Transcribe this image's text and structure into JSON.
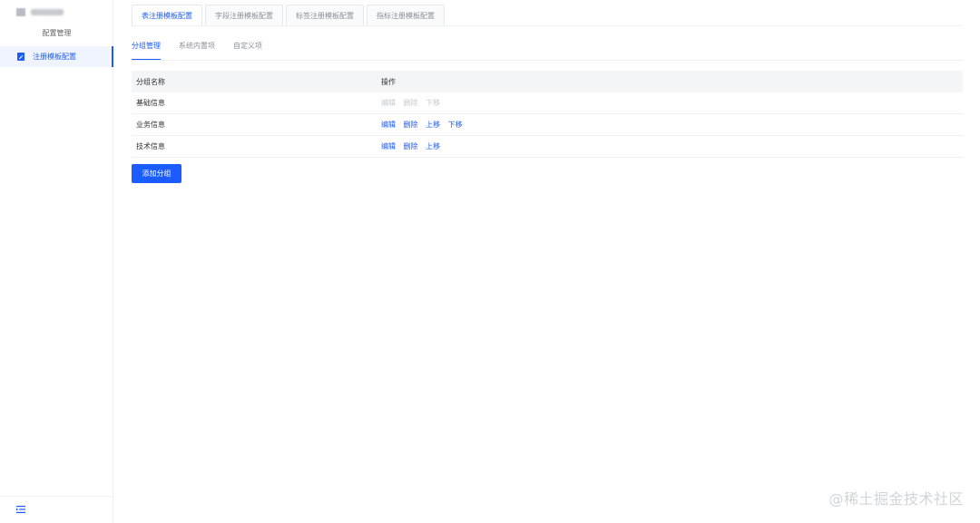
{
  "sidebar": {
    "group_title": "配置管理",
    "items": [
      {
        "label": "注册模板配置",
        "icon": "edit-doc-icon",
        "active": true
      }
    ],
    "collapse_icon": "menu-fold-icon"
  },
  "top_tabs": [
    {
      "label": "表注册模板配置",
      "active": true
    },
    {
      "label": "字段注册模板配置",
      "active": false
    },
    {
      "label": "标签注册模板配置",
      "active": false
    },
    {
      "label": "指标注册模板配置",
      "active": false
    }
  ],
  "sub_tabs": [
    {
      "label": "分组管理",
      "active": true
    },
    {
      "label": "系统内置项",
      "active": false
    },
    {
      "label": "自定义项",
      "active": false
    }
  ],
  "table": {
    "headers": {
      "name": "分组名称",
      "actions": "操作"
    },
    "rows": [
      {
        "name": "基础信息",
        "actions": [
          {
            "label": "编辑",
            "enabled": false
          },
          {
            "label": "删除",
            "enabled": false
          },
          {
            "label": "下移",
            "enabled": false
          }
        ]
      },
      {
        "name": "业务信息",
        "actions": [
          {
            "label": "编辑",
            "enabled": true
          },
          {
            "label": "删除",
            "enabled": true
          },
          {
            "label": "上移",
            "enabled": true
          },
          {
            "label": "下移",
            "enabled": true
          }
        ]
      },
      {
        "name": "技术信息",
        "actions": [
          {
            "label": "编辑",
            "enabled": true
          },
          {
            "label": "删除",
            "enabled": true
          },
          {
            "label": "上移",
            "enabled": true
          }
        ]
      }
    ]
  },
  "add_button_label": "添加分组",
  "watermark": "@稀土掘金技术社区",
  "colors": {
    "accent": "#1a5cff",
    "disabled": "#c6c9ce"
  }
}
